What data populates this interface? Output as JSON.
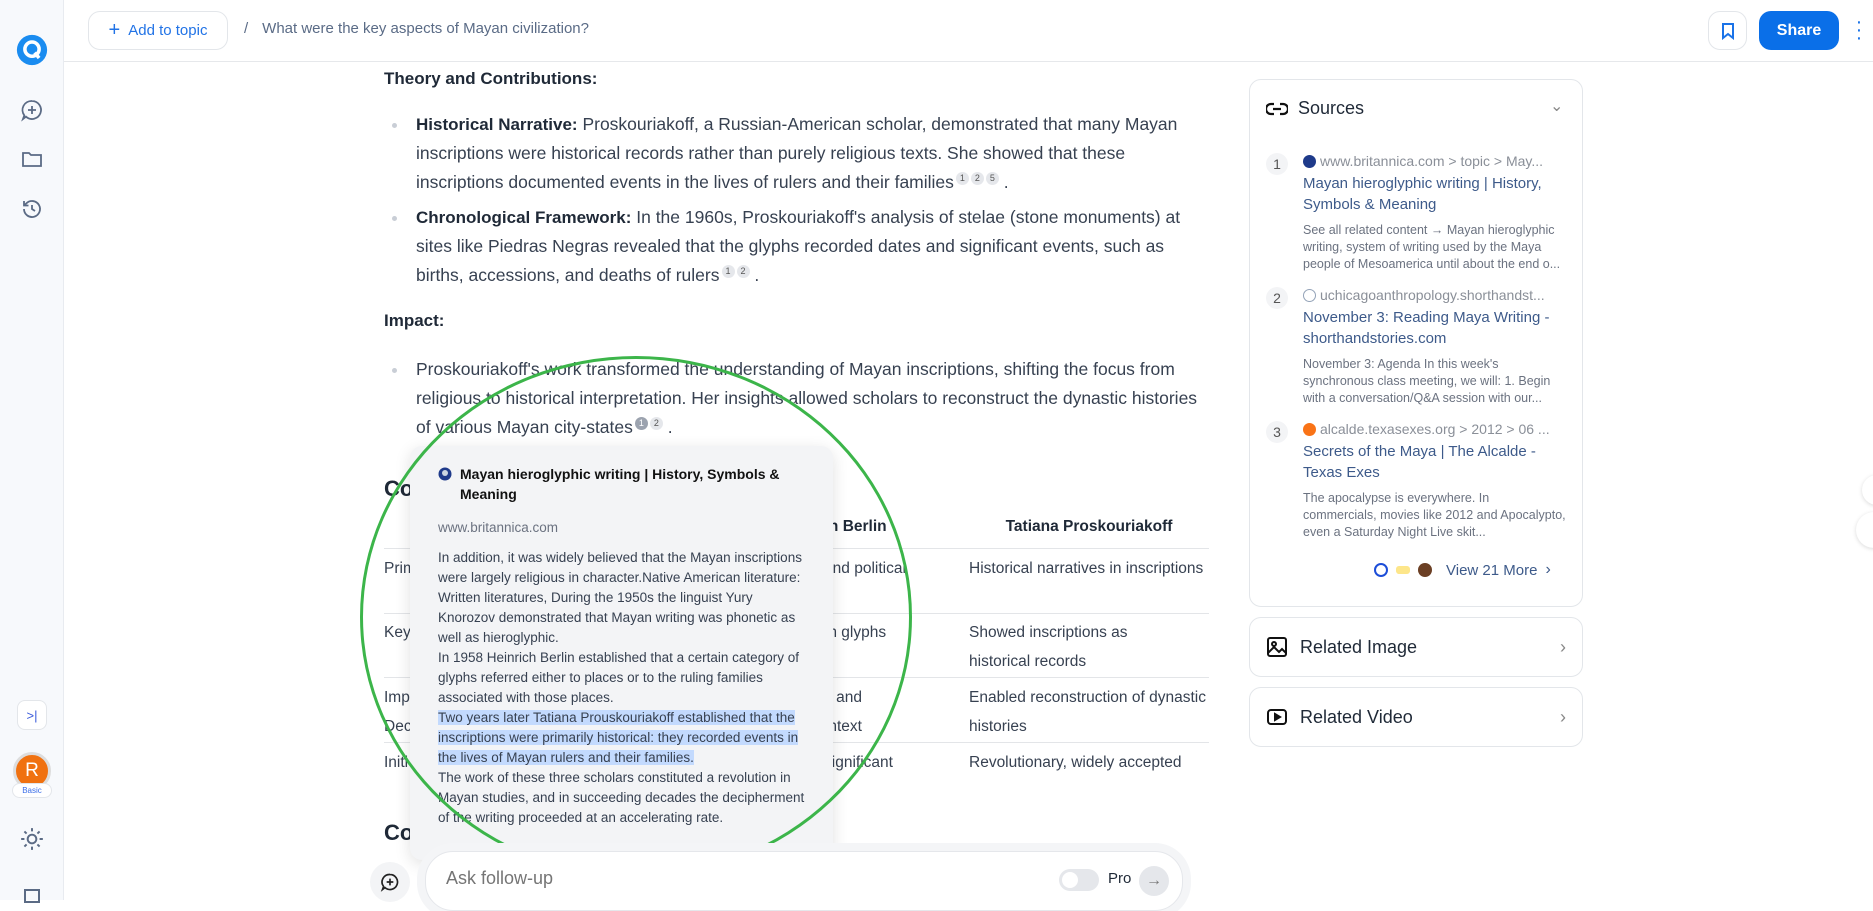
{
  "header": {
    "add_to_topic": "Add to topic",
    "breadcrumb_sep": "/",
    "breadcrumb": "What were the key aspects of Mayan civilization?",
    "share": "Share"
  },
  "sidebar": {
    "avatar_initial": "R",
    "plan": "Basic",
    "collapse": ">|"
  },
  "article": {
    "theory_heading": "Theory and Contributions:",
    "bullets": [
      {
        "bold": "Historical Narrative:",
        "text": " Proskouriakoff, a Russian-American scholar, demonstrated that many Mayan inscriptions were historical records rather than purely religious texts. She showed that these inscriptions documented events in the lives of rulers and their families",
        "cites": [
          "1",
          "2",
          "5"
        ]
      },
      {
        "bold": "Chronological Framework:",
        "text": " In the 1960s, Proskouriakoff's analysis of stelae (stone monuments) at sites like Piedras Negras revealed that the glyphs recorded dates and significant events, such as births, accessions, and deaths of rulers",
        "cites": [
          "1",
          "2"
        ]
      }
    ],
    "impact_heading": "Impact:",
    "impact_bullet": {
      "text": "Proskouriakoff's work transformed the understanding of Mayan inscriptions, shifting the focus from religious to historical interpretation. Her insights allowed scholars to reconstruct the dynastic histories of various Mayan city-states",
      "cites": [
        "1",
        "2"
      ]
    },
    "comparison_heading": "Co",
    "conclusion_heading": "Co",
    "table": {
      "headers": [
        "ich Berlin",
        "Tatiana Proskouriakoff"
      ],
      "rows": [
        {
          "c1": "Prim",
          "c3": "s and political",
          "c4": "Historical narratives in inscriptions"
        },
        {
          "c1": "Key",
          "c3": "lem glyphs",
          "c4": "Showed inscriptions as historical records"
        },
        {
          "c1": "Impa\nDeci",
          "c3": "cal and\ncontext",
          "c4": "Enabled reconstruction of dynastic histories"
        },
        {
          "c1": "Initi",
          "c3": "s significant",
          "c4": "Revolutionary, widely accepted"
        }
      ]
    }
  },
  "popover": {
    "title": "Mayan hieroglyphic writing | History, Symbols & Meaning",
    "domain": "www.britannica.com",
    "text_before": "In addition, it was widely believed that the Mayan inscriptions were largely religious in character.Native American literature: Written literatures, During the 1950s the linguist Yury Knorozov demonstrated that Mayan writing was phonetic as well as hieroglyphic.\nIn 1958 Heinrich Berlin established that a certain category of glyphs referred either to places or to the ruling families associated with those places.",
    "highlight": " Two years later Tatiana Prouskouriakoff established that the inscriptions were primarily historical: they recorded events in the lives of Mayan rulers and their families.",
    "text_after": "The work of these three scholars constituted a revolution in Mayan studies, and in succeeding decades the decipherment of the writing proceeded at an accelerating rate."
  },
  "followup": {
    "placeholder": "Ask follow-up",
    "pro": "Pro"
  },
  "sources": {
    "title": "Sources",
    "items": [
      {
        "num": "1",
        "domain": "www.britannica.com > topic > May...",
        "title": "Mayan hieroglyphic writing | History, Symbols & Meaning",
        "desc": "See all related content → Mayan hieroglyphic writing, system of writing used by the Maya people of Mesoamerica until about the end o...",
        "color": "#1e3a8a"
      },
      {
        "num": "2",
        "domain": "uchicagoanthropology.shorthandst...",
        "title": "November 3: Reading Maya Writing - shorthandstories.com",
        "desc": "November 3: Agenda In this week's synchronous class meeting, we will: 1. Begin with a conversation/Q&A session with our...",
        "color": "#94a3b8"
      },
      {
        "num": "3",
        "domain": "alcalde.texasexes.org > 2012 > 06 ...",
        "title": "Secrets of the Maya | The Alcalde - Texas Exes",
        "desc": "The apocalypse is everywhere. In commercials, movies like 2012 and Apocalypto, even a Saturday Night Live skit...",
        "color": "#f97316"
      }
    ],
    "view_more": "View 21 More"
  },
  "related_image": "Related Image",
  "related_video": "Related Video",
  "colors": {
    "accent": "#0a6fe8",
    "highlight": "#c3dafe",
    "annotation_ring": "#3cb54a",
    "avatar": "#f07110"
  }
}
